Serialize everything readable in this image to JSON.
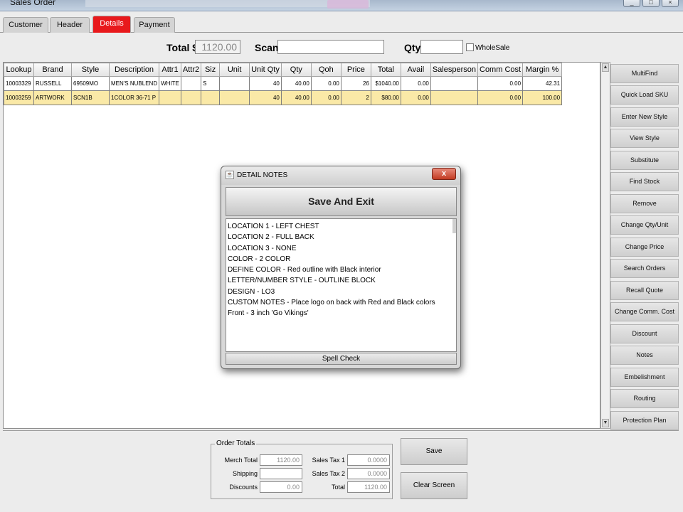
{
  "window": {
    "title": "Sales Order",
    "controls": [
      "_",
      "□",
      "×"
    ]
  },
  "tabs": [
    {
      "label": "Customer"
    },
    {
      "label": "Header"
    },
    {
      "label": "Details",
      "active": true
    },
    {
      "label": "Payment"
    }
  ],
  "totals_bar": {
    "total_label": "Total $",
    "total_value": "1120.00",
    "scan_label": "Scan",
    "scan_value": "",
    "qty_label": "Qty",
    "qty_value": "",
    "wholesale_label": "WholeSale",
    "wholesale_checked": false
  },
  "grid": {
    "columns": [
      "Lookup",
      "Brand",
      "Style",
      "Description",
      "Attr1",
      "Attr2",
      "Siz",
      "Unit",
      "Unit Qty",
      "Qty",
      "Qoh",
      "Price",
      "Total",
      "Avail",
      "Salesperson",
      "Comm Cost",
      "Margin %"
    ],
    "rows": [
      [
        "10003329",
        "RUSSELL",
        "69509MO",
        "MEN'S NUBLEND",
        "WHITE",
        "",
        "S",
        "",
        "40",
        "40.00",
        "0.00",
        "26",
        "$1040.00",
        "0.00",
        "",
        "0.00",
        "42.31"
      ],
      [
        "10003259",
        "ARTWORK",
        "SCN1B",
        "1COLOR 36-71 P",
        "",
        "",
        "",
        "",
        "40",
        "40.00",
        "0.00",
        "2",
        "$80.00",
        "0.00",
        "",
        "0.00",
        "100.00"
      ]
    ],
    "selected_row": 1
  },
  "side_buttons": [
    "MultiFind",
    "Quick Load SKU",
    "Enter New Style",
    "View Style",
    "Substitute",
    "Find Stock",
    "Remove",
    "Change Qty/Unit",
    "Change Price",
    "Search Orders",
    "Recall Quote",
    "Change Comm. Cost",
    "Discount",
    "Notes",
    "Embelishment",
    "Routing",
    "Protection Plan"
  ],
  "order_totals": {
    "legend": "Order Totals",
    "merch_total_label": "Merch Total",
    "merch_total": "1120.00",
    "shipping_label": "Shipping",
    "shipping": "",
    "discounts_label": "Discounts",
    "discounts": "0.00",
    "sales_tax1_label": "Sales Tax 1",
    "sales_tax1": "0.0000",
    "sales_tax2_label": "Sales Tax 2",
    "sales_tax2": "0.0000",
    "total_label": "Total",
    "total": "1120.00"
  },
  "actions": {
    "save": "Save",
    "clear": "Clear Screen"
  },
  "dialog": {
    "title": "DETAIL NOTES",
    "close": "x",
    "save_exit": "Save And Exit",
    "notes": [
      "LOCATION 1 - LEFT CHEST",
      "LOCATION 2 - FULL BACK",
      "LOCATION 3 - NONE",
      "COLOR - 2 COLOR",
      "DEFINE COLOR - Red outline with Black interior",
      "LETTER/NUMBER STYLE - OUTLINE BLOCK",
      "DESIGN - LO3",
      "CUSTOM NOTES - Place logo on back with Red and Black colors",
      "Front - 3 inch 'Go Vikings'"
    ],
    "spell_check": "Spell Check"
  },
  "colors": {
    "active_tab": "#e8191c",
    "selected_row": "#fae9a7",
    "close_button": "#c23b22"
  }
}
